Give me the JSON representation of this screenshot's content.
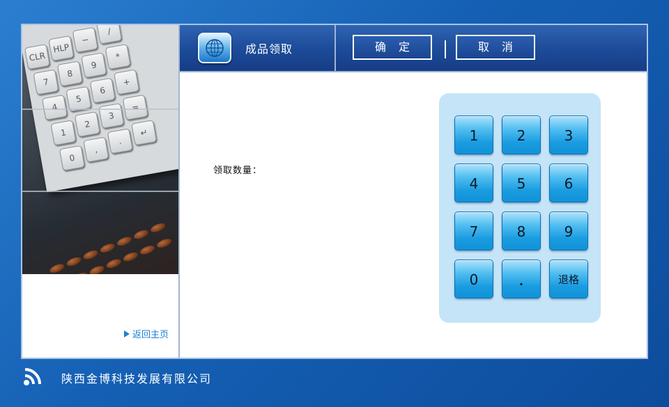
{
  "header": {
    "title": "成品领取",
    "confirm_label": "确定",
    "cancel_label": "取消"
  },
  "sidebar": {
    "return_label": "返回主页"
  },
  "form": {
    "quantity_label": "领取数量："
  },
  "keypad": {
    "keys": [
      "1",
      "2",
      "3",
      "4",
      "5",
      "6",
      "7",
      "8",
      "9",
      "0",
      ".",
      "退格"
    ]
  },
  "footer": {
    "company": "陕西金博科技发展有限公司"
  },
  "icons": {
    "title_icon": "globe-icon",
    "footer_icon": "signal-icon",
    "return_icon": "triangle-right-icon"
  },
  "colors": {
    "background": "#1560b4",
    "header": "#1d4c9a",
    "keypad_bg": "#c5e4f7",
    "key": "#1a9ce0",
    "link": "#1b7fd6"
  }
}
